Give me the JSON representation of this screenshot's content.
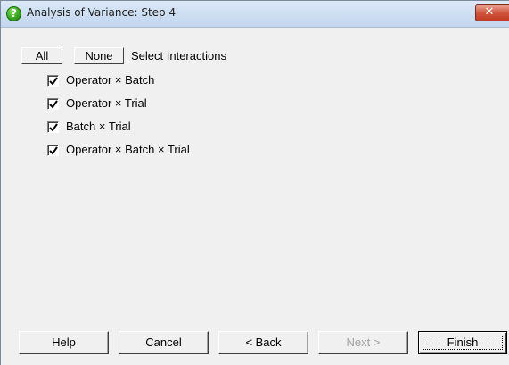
{
  "window": {
    "title": "Analysis of Variance: Step 4",
    "close_glyph": "✕"
  },
  "toolbar": {
    "all_label": "All",
    "none_label": "None",
    "select_label": "Select Interactions"
  },
  "interactions": [
    {
      "label": "Operator × Batch",
      "checked": true
    },
    {
      "label": "Operator × Trial",
      "checked": true
    },
    {
      "label": "Batch × Trial",
      "checked": true
    },
    {
      "label": "Operator × Batch × Trial",
      "checked": true
    }
  ],
  "buttons": {
    "help": "Help",
    "cancel": "Cancel",
    "back": "< Back",
    "next": "Next >",
    "finish": "Finish"
  },
  "icons": {
    "title_icon": "question-icon",
    "checkmark": "checkmark-icon"
  },
  "colors": {
    "dialog_bg": "#f0f0f0",
    "close_button": "#c94a31",
    "title_icon": "#3aa81e",
    "disabled_text": "#a0a0a0"
  }
}
